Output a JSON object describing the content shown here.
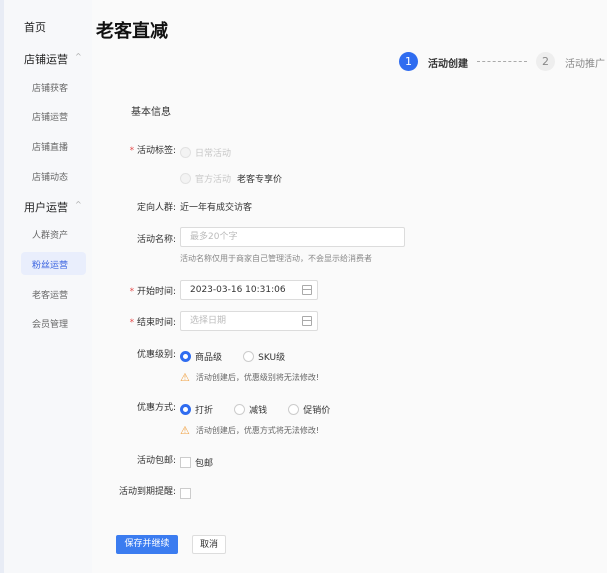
{
  "sidebar": {
    "items": [
      {
        "label": "首页"
      },
      {
        "label": "店铺运营",
        "children": [
          "店铺获客",
          "店铺运营",
          "店铺直播",
          "店铺动态"
        ]
      },
      {
        "label": "用户运营",
        "children": [
          "人群资产",
          "粉丝运营",
          "老客运营",
          "会员管理"
        ]
      }
    ],
    "active": "粉丝运营"
  },
  "page": {
    "title": "老客直减"
  },
  "steps": [
    {
      "num": "1",
      "label": "活动创建",
      "state": "active"
    },
    {
      "num": "2",
      "label": "活动推广",
      "state": "pending"
    }
  ],
  "form": {
    "section": "基本信息",
    "tag_label": "活动标签:",
    "tag_options": [
      "日常活动",
      "官方活动"
    ],
    "tag_official_value": "老客专享价",
    "audience_label": "定向人群:",
    "audience_value": "近一年有成交访客",
    "name_label": "活动名称:",
    "name_placeholder": "最多20个字",
    "name_hint": "活动名称仅用于商家自己管理活动，不会显示给消费者",
    "start_label": "开始时间:",
    "start_value": "2023-03-16 10:31:06",
    "end_label": "结束时间:",
    "end_placeholder": "选择日期",
    "level_label": "优惠级别:",
    "level_options": [
      "商品级",
      "SKU级"
    ],
    "level_warning": "活动创建后，优惠级别将无法修改!",
    "method_label": "优惠方式:",
    "method_options": [
      "打折",
      "减钱",
      "促销价"
    ],
    "method_warning": "活动创建后，优惠方式将无法修改!",
    "shipping_label": "活动包邮:",
    "shipping_option": "包邮",
    "reminder_label": "活动到期提醒:",
    "save": "保存并继续",
    "cancel": "取消"
  },
  "colors": {
    "primary": "#2f6cf0",
    "warning": "#f0a040",
    "required": "#e34d4d"
  }
}
